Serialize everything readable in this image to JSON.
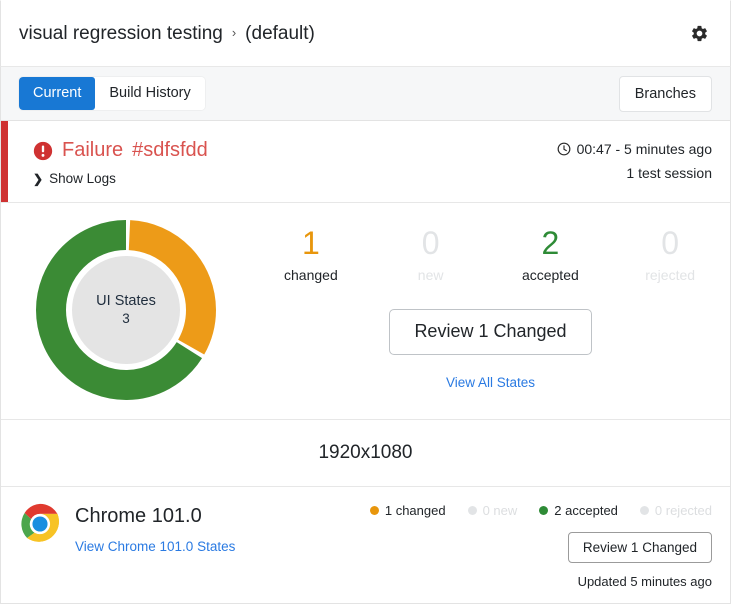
{
  "header": {
    "project": "visual regression testing",
    "separator": "›",
    "branch": "(default)",
    "settings_icon": "gear-icon"
  },
  "tabs": {
    "items": [
      {
        "label": "Current",
        "active": true
      },
      {
        "label": "Build History",
        "active": false
      }
    ],
    "branches_label": "Branches"
  },
  "failure": {
    "icon": "exclamation-circle-icon",
    "status": "Failure",
    "build_id": "#sdfsfdd",
    "show_logs": "Show Logs",
    "chevron": "❯",
    "clock_icon": "clock-icon",
    "duration_text": "00:47 - 5 minutes ago",
    "sessions_text": "1 test session",
    "accent_color": "#cf3232",
    "text_color": "#d9534f"
  },
  "summary": {
    "donut": {
      "center_label": "UI States",
      "center_value": "3"
    },
    "stats": [
      {
        "key": "changed",
        "value": "1",
        "label": "changed",
        "color": "#e8960c"
      },
      {
        "key": "new",
        "value": "0",
        "label": "new",
        "color": "#e2e4e6"
      },
      {
        "key": "accepted",
        "value": "2",
        "label": "accepted",
        "color": "#2e8b36"
      },
      {
        "key": "rejected",
        "value": "0",
        "label": "rejected",
        "color": "#e2e4e6"
      }
    ],
    "review_button": "Review 1 Changed",
    "view_all_link": "View All States"
  },
  "resolution": "1920x1080",
  "browser": {
    "icon": "chrome-icon",
    "name": "Chrome 101.0",
    "states_link": "View Chrome 101.0 States",
    "legend": [
      {
        "label": "1 changed",
        "color": "#e8960c",
        "muted": false
      },
      {
        "label": "0 new",
        "color": "#e2e4e6",
        "muted": true
      },
      {
        "label": "2 accepted",
        "color": "#2e8b36",
        "muted": false
      },
      {
        "label": "0 rejected",
        "color": "#e2e4e6",
        "muted": true
      }
    ],
    "review_button": "Review 1 Changed",
    "updated": "Updated 5 minutes ago"
  },
  "chart_data": {
    "type": "pie",
    "title": "UI States",
    "categories": [
      "changed",
      "accepted"
    ],
    "values": [
      1,
      2
    ],
    "colors": [
      "#ed9b18",
      "#3b8b35"
    ],
    "total": 3,
    "center_label": "UI States",
    "center_value": "3",
    "legend": "none",
    "donut": true
  }
}
